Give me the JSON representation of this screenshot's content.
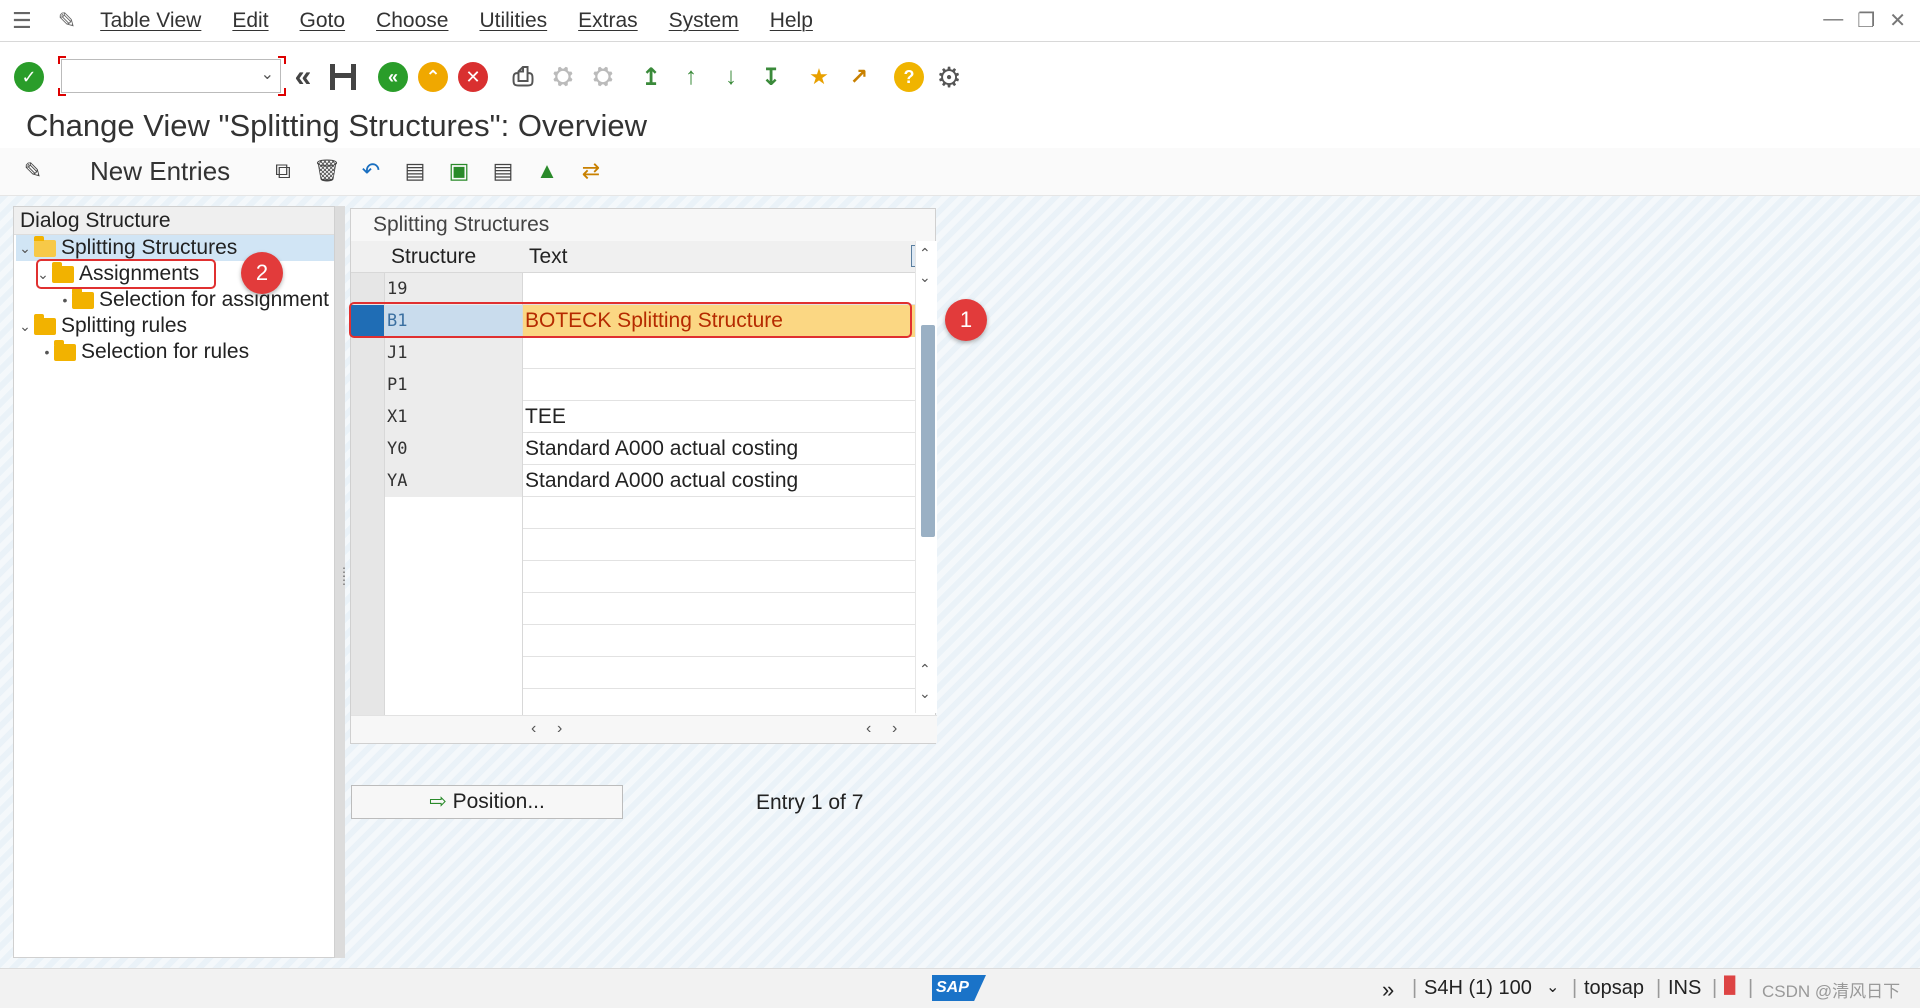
{
  "menubar": {
    "items": [
      "Table View",
      "Edit",
      "Goto",
      "Choose",
      "Utilities",
      "Extras",
      "System",
      "Help"
    ]
  },
  "toolbar": {
    "command_field_value": ""
  },
  "title": "Change View \"Splitting Structures\": Overview",
  "app_toolbar": {
    "new_entries_label": "New Entries"
  },
  "dialog_structure": {
    "header": "Dialog Structure",
    "items": [
      {
        "label": "Splitting Structures",
        "level": 0
      },
      {
        "label": "Assignments",
        "level": 1
      },
      {
        "label": "Selection for assignment",
        "level": 2
      },
      {
        "label": "Splitting rules",
        "level": 0
      },
      {
        "label": "Selection for rules",
        "level": 1
      }
    ]
  },
  "table": {
    "caption": "Splitting Structures",
    "columns": [
      "Structure",
      "Text"
    ],
    "rows": [
      {
        "structure": "19",
        "text": ""
      },
      {
        "structure": "B1",
        "text": "BOTECK  Splitting Structure"
      },
      {
        "structure": "J1",
        "text": ""
      },
      {
        "structure": "P1",
        "text": ""
      },
      {
        "structure": "X1",
        "text": "TEE"
      },
      {
        "structure": "Y0",
        "text": "Standard A000 actual costing"
      },
      {
        "structure": "YA",
        "text": "Standard A000 actual costing"
      }
    ]
  },
  "annotations": {
    "badge1": "1",
    "badge2": "2"
  },
  "position_button_label": "Position...",
  "entry_info": "Entry 1 of 7",
  "statusbar": {
    "system": "S4H (1) 100",
    "server": "topsap",
    "mode": "INS",
    "watermark": "CSDN @清风日下"
  },
  "colors": {
    "highlight_row_bg": "#fbd783",
    "highlight_text": "#b52a00",
    "annotation_red": "#e23b3b",
    "tree_selected_bg": "#d1e5f5"
  }
}
